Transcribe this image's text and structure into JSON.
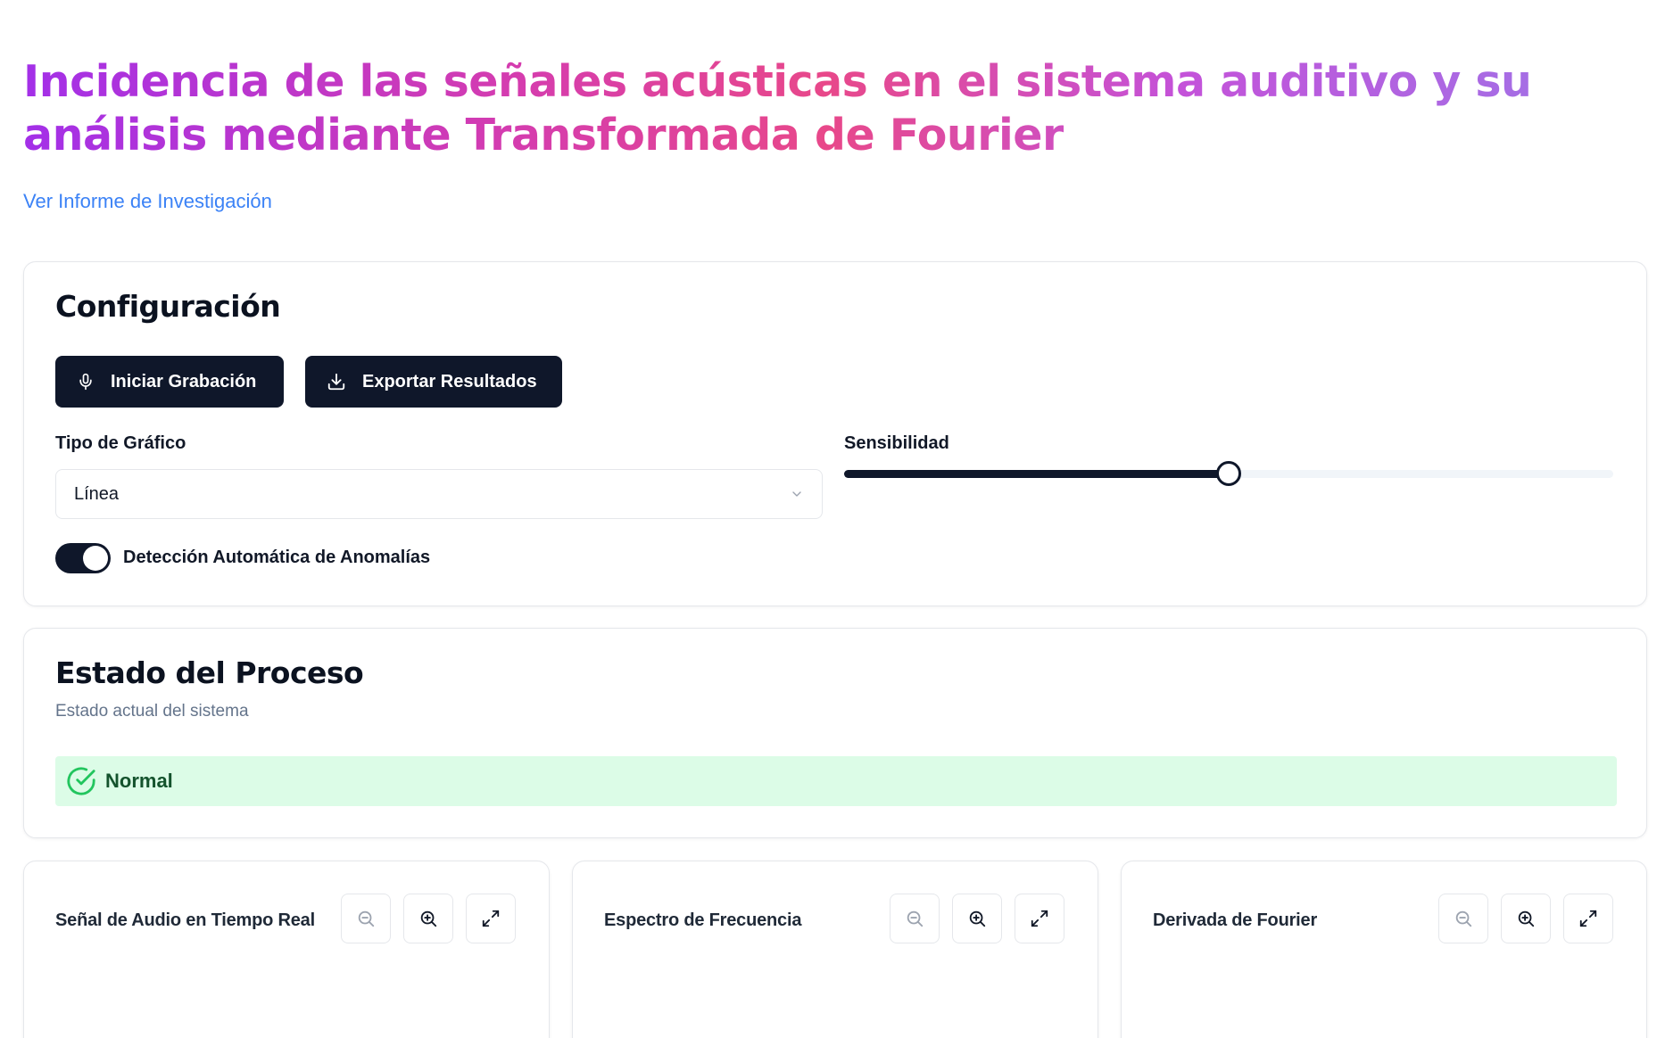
{
  "header": {
    "title": "Incidencia de las señales acústicas en el sistema auditivo y su análisis mediante Transformada de Fourier",
    "report_link": "Ver Informe de Investigación"
  },
  "config": {
    "title": "Configuración",
    "record_button": "Iniciar Grabación",
    "export_button": "Exportar Resultados",
    "chart_type_label": "Tipo de Gráfico",
    "chart_type_value": "Línea",
    "sensitivity_label": "Sensibilidad",
    "sensitivity_fraction": 0.5,
    "anomaly_toggle_label": "Detección Automática de Anomalías",
    "anomaly_toggle_on": true
  },
  "process": {
    "title": "Estado del Proceso",
    "subtitle": "Estado actual del sistema",
    "status": "Normal",
    "status_color": "#dcfce7"
  },
  "charts": [
    {
      "title": "Señal de Audio en Tiempo Real"
    },
    {
      "title": "Espectro de Frecuencia"
    },
    {
      "title": "Derivada de Fourier"
    }
  ],
  "icons": {
    "record": "microphone-icon",
    "export": "download-icon",
    "select": "chevron-down-icon",
    "status": "check-circle-icon",
    "zoom_out": "zoom-out-icon",
    "zoom_in": "zoom-in-icon",
    "expand": "expand-icon"
  },
  "colors": {
    "primary": "#0f172a",
    "link": "#3b82f6",
    "success_bg": "#dcfce7",
    "success_icon": "#22c55e"
  }
}
